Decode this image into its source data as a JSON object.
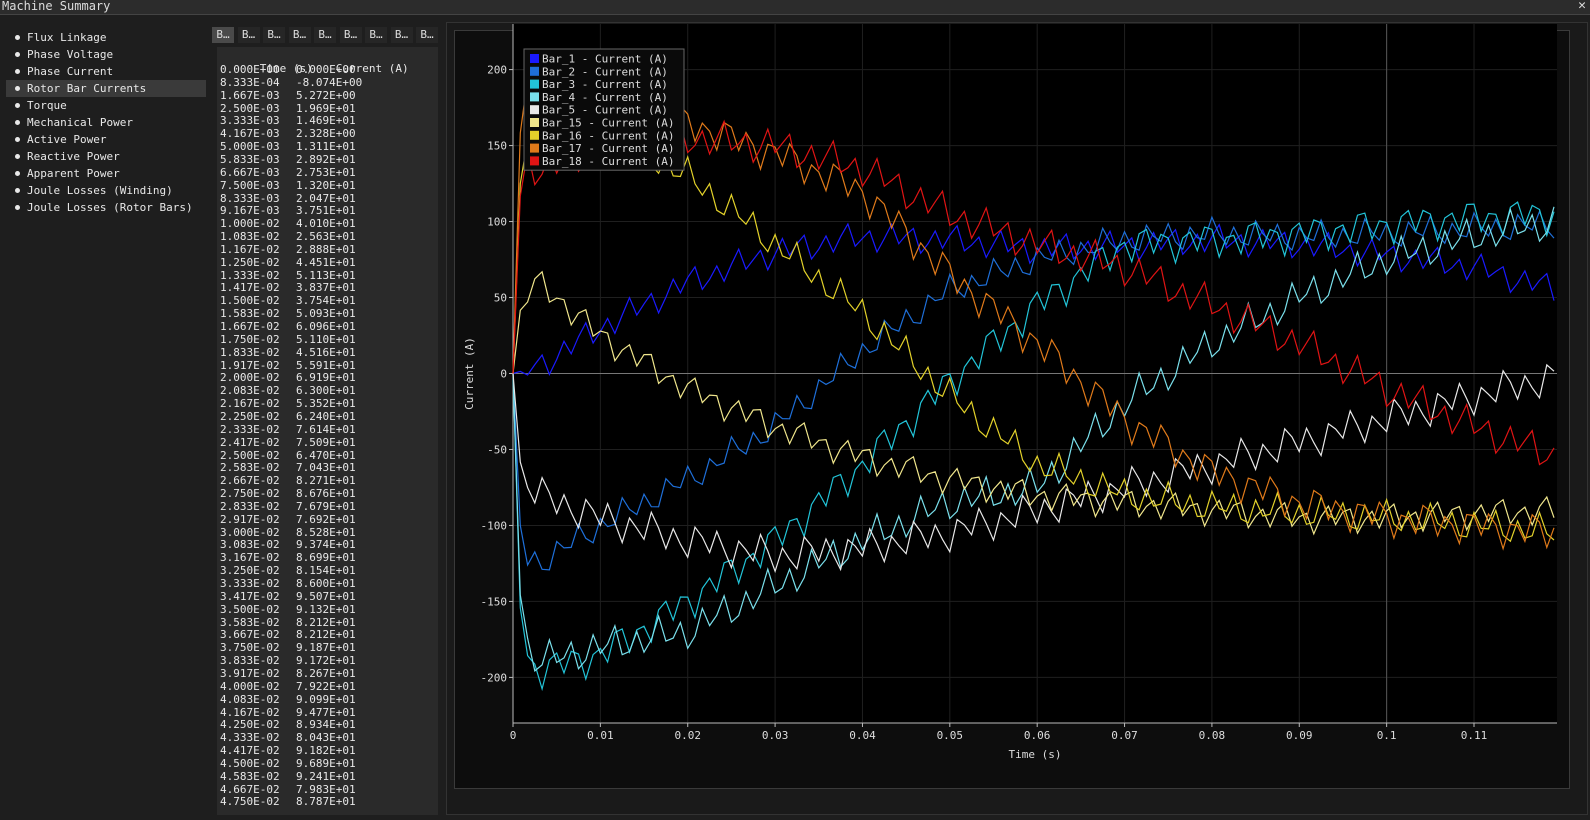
{
  "window": {
    "title": "Machine Summary",
    "close_icon": "close-icon"
  },
  "menu": {
    "items": [
      {
        "label": "Flux Linkage"
      },
      {
        "label": "Phase Voltage"
      },
      {
        "label": "Phase Current"
      },
      {
        "label": "Rotor Bar Currents",
        "active": true
      },
      {
        "label": "Torque"
      },
      {
        "label": "Mechanical Power"
      },
      {
        "label": "Active Power"
      },
      {
        "label": "Reactive Power"
      },
      {
        "label": "Apparent Power"
      },
      {
        "label": "Joule Losses (Winding)"
      },
      {
        "label": "Joule Losses (Rotor Bars)"
      }
    ]
  },
  "tabs": [
    "B…",
    "B…",
    "B…",
    "B…",
    "B…",
    "B…",
    "B…",
    "B…",
    "B…"
  ],
  "table": {
    "headers": [
      "Time (s)",
      "Current (A)"
    ],
    "rows": [
      [
        "0.000E+00",
        "0.000E+00"
      ],
      [
        "8.333E-04",
        "-8.074E+00"
      ],
      [
        "1.667E-03",
        "5.272E+00"
      ],
      [
        "2.500E-03",
        "1.969E+01"
      ],
      [
        "3.333E-03",
        "1.469E+01"
      ],
      [
        "4.167E-03",
        "2.328E+00"
      ],
      [
        "5.000E-03",
        "1.311E+01"
      ],
      [
        "5.833E-03",
        "2.892E+01"
      ],
      [
        "6.667E-03",
        "2.753E+01"
      ],
      [
        "7.500E-03",
        "1.320E+01"
      ],
      [
        "8.333E-03",
        "2.047E+01"
      ],
      [
        "9.167E-03",
        "3.751E+01"
      ],
      [
        "1.000E-02",
        "4.010E+01"
      ],
      [
        "1.083E-02",
        "2.563E+01"
      ],
      [
        "1.167E-02",
        "2.888E+01"
      ],
      [
        "1.250E-02",
        "4.451E+01"
      ],
      [
        "1.333E-02",
        "5.113E+01"
      ],
      [
        "1.417E-02",
        "3.837E+01"
      ],
      [
        "1.500E-02",
        "3.754E+01"
      ],
      [
        "1.583E-02",
        "5.093E+01"
      ],
      [
        "1.667E-02",
        "6.096E+01"
      ],
      [
        "1.750E-02",
        "5.110E+01"
      ],
      [
        "1.833E-02",
        "4.516E+01"
      ],
      [
        "1.917E-02",
        "5.591E+01"
      ],
      [
        "2.000E-02",
        "6.919E+01"
      ],
      [
        "2.083E-02",
        "6.300E+01"
      ],
      [
        "2.167E-02",
        "5.352E+01"
      ],
      [
        "2.250E-02",
        "6.240E+01"
      ],
      [
        "2.333E-02",
        "7.614E+01"
      ],
      [
        "2.417E-02",
        "7.509E+01"
      ],
      [
        "2.500E-02",
        "6.470E+01"
      ],
      [
        "2.583E-02",
        "7.043E+01"
      ],
      [
        "2.667E-02",
        "8.271E+01"
      ],
      [
        "2.750E-02",
        "8.676E+01"
      ],
      [
        "2.833E-02",
        "7.679E+01"
      ],
      [
        "2.917E-02",
        "7.692E+01"
      ],
      [
        "3.000E-02",
        "8.528E+01"
      ],
      [
        "3.083E-02",
        "9.374E+01"
      ],
      [
        "3.167E-02",
        "8.699E+01"
      ],
      [
        "3.250E-02",
        "8.154E+01"
      ],
      [
        "3.333E-02",
        "8.600E+01"
      ],
      [
        "3.417E-02",
        "9.507E+01"
      ],
      [
        "3.500E-02",
        "9.132E+01"
      ],
      [
        "3.583E-02",
        "8.212E+01"
      ],
      [
        "3.667E-02",
        "8.212E+01"
      ],
      [
        "3.750E-02",
        "9.187E+01"
      ],
      [
        "3.833E-02",
        "9.172E+01"
      ],
      [
        "3.917E-02",
        "8.267E+01"
      ],
      [
        "4.000E-02",
        "7.922E+01"
      ],
      [
        "4.083E-02",
        "9.099E+01"
      ],
      [
        "4.167E-02",
        "9.477E+01"
      ],
      [
        "4.250E-02",
        "8.934E+01"
      ],
      [
        "4.333E-02",
        "8.043E+01"
      ],
      [
        "4.417E-02",
        "9.182E+01"
      ],
      [
        "4.500E-02",
        "9.689E+01"
      ],
      [
        "4.583E-02",
        "9.241E+01"
      ],
      [
        "4.667E-02",
        "7.983E+01"
      ],
      [
        "4.750E-02",
        "8.787E+01"
      ]
    ]
  },
  "chart_data": {
    "type": "line",
    "xlabel": "Time (s)",
    "ylabel": "Current (A)",
    "xlim": [
      0,
      0.1195
    ],
    "ylim": [
      -230,
      230
    ],
    "xticks": [
      0,
      0.01,
      0.02,
      0.03,
      0.04,
      0.05,
      0.06,
      0.07,
      0.08,
      0.09,
      0.1,
      0.11
    ],
    "xtick_labels": [
      "0",
      "0.01",
      "0.02",
      "0.03",
      "0.04",
      "0.05",
      "0.06",
      "0.07",
      "0.08",
      "0.09",
      "0.1",
      "0.11"
    ],
    "yticks": [
      -200,
      -150,
      -100,
      -50,
      0,
      50,
      100,
      150,
      200
    ],
    "ytick_labels": [
      "-200",
      "-150",
      "-100",
      "-50",
      "0",
      "50",
      "100",
      "150",
      "200"
    ],
    "grid": true,
    "legend_position": "top-left",
    "ripple_period_s": 0.0025,
    "series": [
      {
        "name": "Bar_1 - Current (A)",
        "color": "#1a1aff",
        "x": [
          0,
          0.003,
          0.01,
          0.02,
          0.03,
          0.04,
          0.05,
          0.06,
          0.07,
          0.08,
          0.09,
          0.1,
          0.11,
          0.1195
        ],
        "y": [
          0,
          5,
          30,
          60,
          80,
          90,
          88,
          82,
          84,
          88,
          85,
          78,
          70,
          55
        ],
        "ripple": 8
      },
      {
        "name": "Bar_2 - Current (A)",
        "color": "#1e6fd9",
        "x": [
          0,
          0.001,
          0.003,
          0.01,
          0.02,
          0.03,
          0.04,
          0.05,
          0.06,
          0.07,
          0.08,
          0.09,
          0.1,
          0.11,
          0.1195
        ],
        "y": [
          0,
          -120,
          -125,
          -100,
          -70,
          -35,
          15,
          55,
          75,
          88,
          92,
          90,
          92,
          95,
          98
        ],
        "ripple": 8
      },
      {
        "name": "Bar_3 - Current (A)",
        "color": "#22c4d8",
        "x": [
          0,
          0.001,
          0.003,
          0.01,
          0.02,
          0.03,
          0.04,
          0.05,
          0.06,
          0.07,
          0.08,
          0.09,
          0.1,
          0.11,
          0.1195
        ],
        "y": [
          0,
          -185,
          -195,
          -185,
          -150,
          -110,
          -60,
          -5,
          45,
          85,
          88,
          92,
          98,
          103,
          105
        ],
        "ripple": 10
      },
      {
        "name": "Bar_4 - Current (A)",
        "color": "#7ae0ec",
        "x": [
          0,
          0.001,
          0.003,
          0.01,
          0.02,
          0.03,
          0.04,
          0.05,
          0.06,
          0.07,
          0.08,
          0.09,
          0.1,
          0.11,
          0.1195
        ],
        "y": [
          0,
          -175,
          -190,
          -180,
          -170,
          -140,
          -110,
          -85,
          -75,
          -20,
          20,
          50,
          75,
          90,
          100
        ],
        "ripple": 10
      },
      {
        "name": "Bar_5 - Current (A)",
        "color": "#e8e8e8",
        "x": [
          0,
          0.001,
          0.003,
          0.01,
          0.02,
          0.03,
          0.04,
          0.05,
          0.06,
          0.07,
          0.08,
          0.09,
          0.1,
          0.11,
          0.1195
        ],
        "y": [
          0,
          -70,
          -80,
          -95,
          -110,
          -120,
          -115,
          -105,
          -90,
          -75,
          -60,
          -45,
          -30,
          -15,
          -2
        ],
        "ripple": 10
      },
      {
        "name": "Bar_15 - Current (A)",
        "color": "#f0e68c",
        "x": [
          0,
          0.001,
          0.003,
          0.01,
          0.02,
          0.03,
          0.04,
          0.05,
          0.06,
          0.07,
          0.08,
          0.09,
          0.1,
          0.11,
          0.1195
        ],
        "y": [
          0,
          50,
          60,
          25,
          -10,
          -35,
          -55,
          -70,
          -80,
          -85,
          -90,
          -95,
          -95,
          -92,
          -90
        ],
        "ripple": 8
      },
      {
        "name": "Bar_16 - Current (A)",
        "color": "#e2d12a",
        "x": [
          0,
          0.001,
          0.003,
          0.01,
          0.02,
          0.03,
          0.04,
          0.05,
          0.06,
          0.07,
          0.08,
          0.09,
          0.1,
          0.11,
          0.1195
        ],
        "y": [
          0,
          150,
          165,
          160,
          130,
          85,
          40,
          -15,
          -60,
          -80,
          -88,
          -92,
          -95,
          -100,
          -105
        ],
        "ripple": 9
      },
      {
        "name": "Bar_17 - Current (A)",
        "color": "#e07a1a",
        "x": [
          0,
          0.001,
          0.003,
          0.01,
          0.02,
          0.03,
          0.04,
          0.05,
          0.06,
          0.07,
          0.08,
          0.09,
          0.1,
          0.11,
          0.1195
        ],
        "y": [
          0,
          190,
          175,
          170,
          165,
          145,
          120,
          65,
          20,
          -30,
          -65,
          -85,
          -95,
          -100,
          -105
        ],
        "ripple": 10
      },
      {
        "name": "Bar_18 - Current (A)",
        "color": "#e01414",
        "x": [
          0,
          0.001,
          0.003,
          0.01,
          0.02,
          0.03,
          0.04,
          0.05,
          0.06,
          0.07,
          0.08,
          0.09,
          0.1,
          0.11,
          0.1195
        ],
        "y": [
          0,
          140,
          135,
          145,
          155,
          150,
          135,
          105,
          85,
          70,
          45,
          20,
          -10,
          -35,
          -55
        ],
        "ripple": 10
      }
    ]
  }
}
